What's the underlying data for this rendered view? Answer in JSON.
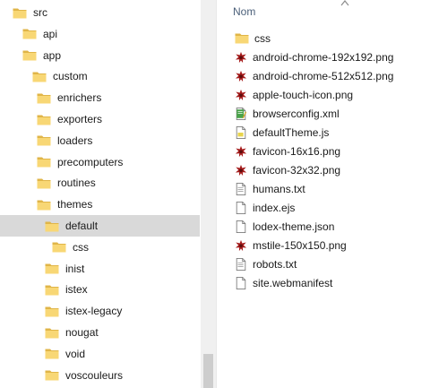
{
  "tree": {
    "items": [
      {
        "label": "src",
        "depth": 0,
        "selected": false
      },
      {
        "label": "api",
        "depth": 1,
        "selected": false
      },
      {
        "label": "app",
        "depth": 1,
        "selected": false
      },
      {
        "label": "custom",
        "depth": 2,
        "selected": false
      },
      {
        "label": "enrichers",
        "depth": 3,
        "selected": false
      },
      {
        "label": "exporters",
        "depth": 3,
        "selected": false
      },
      {
        "label": "loaders",
        "depth": 3,
        "selected": false
      },
      {
        "label": "precomputers",
        "depth": 3,
        "selected": false
      },
      {
        "label": "routines",
        "depth": 3,
        "selected": false
      },
      {
        "label": "themes",
        "depth": 3,
        "selected": false
      },
      {
        "label": "default",
        "depth": 4,
        "selected": true
      },
      {
        "label": "css",
        "depth": 5,
        "selected": false
      },
      {
        "label": "inist",
        "depth": 4,
        "selected": false
      },
      {
        "label": "istex",
        "depth": 4,
        "selected": false
      },
      {
        "label": "istex-legacy",
        "depth": 4,
        "selected": false
      },
      {
        "label": "nougat",
        "depth": 4,
        "selected": false
      },
      {
        "label": "void",
        "depth": 4,
        "selected": false
      },
      {
        "label": "voscouleurs",
        "depth": 4,
        "selected": false
      }
    ]
  },
  "files": {
    "column_header": "Nom",
    "sort_icon": "chevron-up-icon",
    "items": [
      {
        "label": "css",
        "icon": "folder-icon"
      },
      {
        "label": "android-chrome-192x192.png",
        "icon": "png-image-icon"
      },
      {
        "label": "android-chrome-512x512.png",
        "icon": "png-image-icon"
      },
      {
        "label": "apple-touch-icon.png",
        "icon": "png-image-icon"
      },
      {
        "label": "browserconfig.xml",
        "icon": "xml-file-icon"
      },
      {
        "label": "defaultTheme.js",
        "icon": "js-file-icon"
      },
      {
        "label": "favicon-16x16.png",
        "icon": "png-image-icon"
      },
      {
        "label": "favicon-32x32.png",
        "icon": "png-image-icon"
      },
      {
        "label": "humans.txt",
        "icon": "text-file-icon"
      },
      {
        "label": "index.ejs",
        "icon": "generic-file-icon"
      },
      {
        "label": "lodex-theme.json",
        "icon": "generic-file-icon"
      },
      {
        "label": "mstile-150x150.png",
        "icon": "png-image-icon"
      },
      {
        "label": "robots.txt",
        "icon": "text-file-icon"
      },
      {
        "label": "site.webmanifest",
        "icon": "generic-file-icon"
      }
    ]
  },
  "colors": {
    "folder": "#f8d775",
    "folder_dark": "#e0b548",
    "selection": "#d9d9d9",
    "header_text": "#4c607a",
    "png_icon": "#a61c1c"
  }
}
